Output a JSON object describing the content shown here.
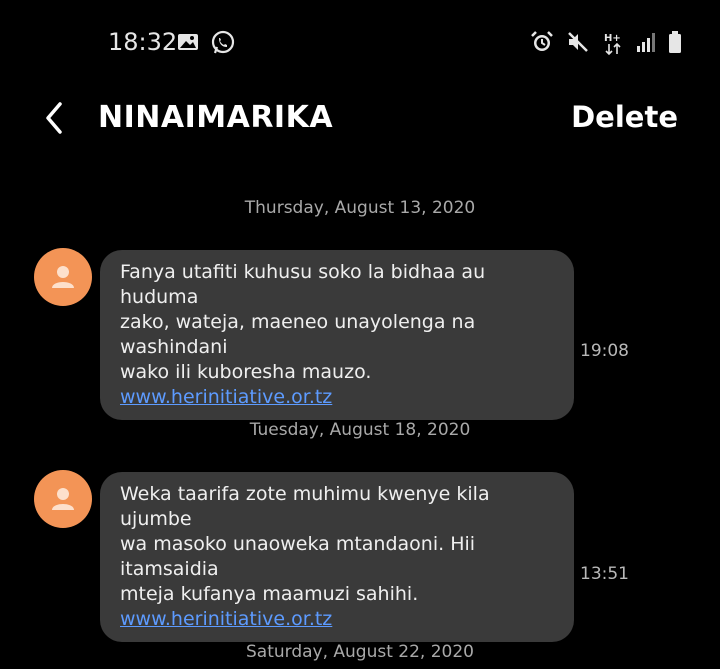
{
  "status_bar": {
    "time": "18:32",
    "network_label": "H+",
    "icons": [
      "gallery-icon",
      "whatsapp-icon",
      "alarm-icon",
      "mute-icon",
      "network-icon",
      "signal-icon",
      "battery-icon"
    ]
  },
  "header": {
    "title": "NINAIMARIKA",
    "delete_label": "Delete"
  },
  "conversation": {
    "messages": [
      {
        "date": "Thursday, August 13, 2020",
        "text_lines": [
          "Fanya utafiti kuhusu soko la bidhaa au huduma",
          "zako, wateja, maeneo unayolenga na washindani",
          "wako ili kuboresha mauzo."
        ],
        "link": "www.herinitiative.or.tz",
        "time": "19:08"
      },
      {
        "date": "Tuesday, August 18, 2020",
        "text_lines": [
          "Weka taarifa zote muhimu kwenye kila ujumbe",
          "wa masoko unaoweka mtandaoni. Hii itamsaidia",
          "mteja kufanya maamuzi sahihi."
        ],
        "link": "www.herinitiative.or.tz",
        "time": "13:51"
      }
    ],
    "next_date": "Saturday, August 22, 2020"
  },
  "colors": {
    "background": "#000000",
    "bubble": "#3a3a3a",
    "avatar": "#f39456",
    "link": "#5d9bff",
    "date_text": "#a9a9a9"
  }
}
